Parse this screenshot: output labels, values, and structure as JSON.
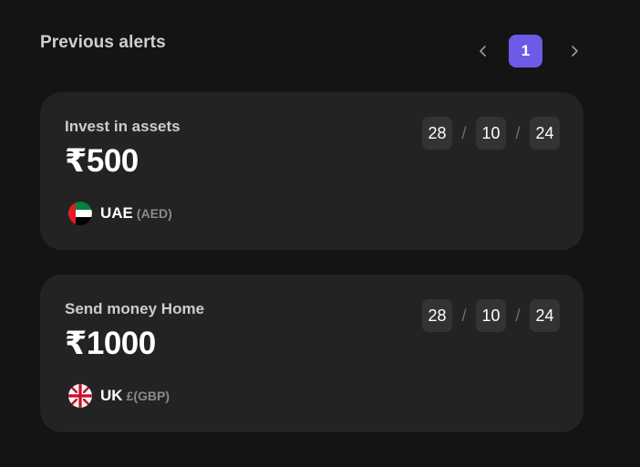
{
  "header": {
    "title": "Previous alerts",
    "pagination": {
      "prev_icon": "chevron-left-icon",
      "current_page": "1",
      "next_icon": "chevron-right-icon",
      "accent_color": "#6d5ae6"
    }
  },
  "alerts": [
    {
      "label": "Invest in assets",
      "amount": "₹500",
      "date": {
        "day": "28",
        "month": "10",
        "year": "24",
        "separator": "/"
      },
      "country": {
        "code": "UAE",
        "currency": "(AED)",
        "flag": "uae-flag-icon"
      }
    },
    {
      "label": "Send money Home",
      "amount": "₹1000",
      "date": {
        "day": "28",
        "month": "10",
        "year": "24",
        "separator": "/"
      },
      "country": {
        "code": "UK",
        "currency": "£(GBP)",
        "flag": "uk-flag-icon"
      }
    }
  ]
}
